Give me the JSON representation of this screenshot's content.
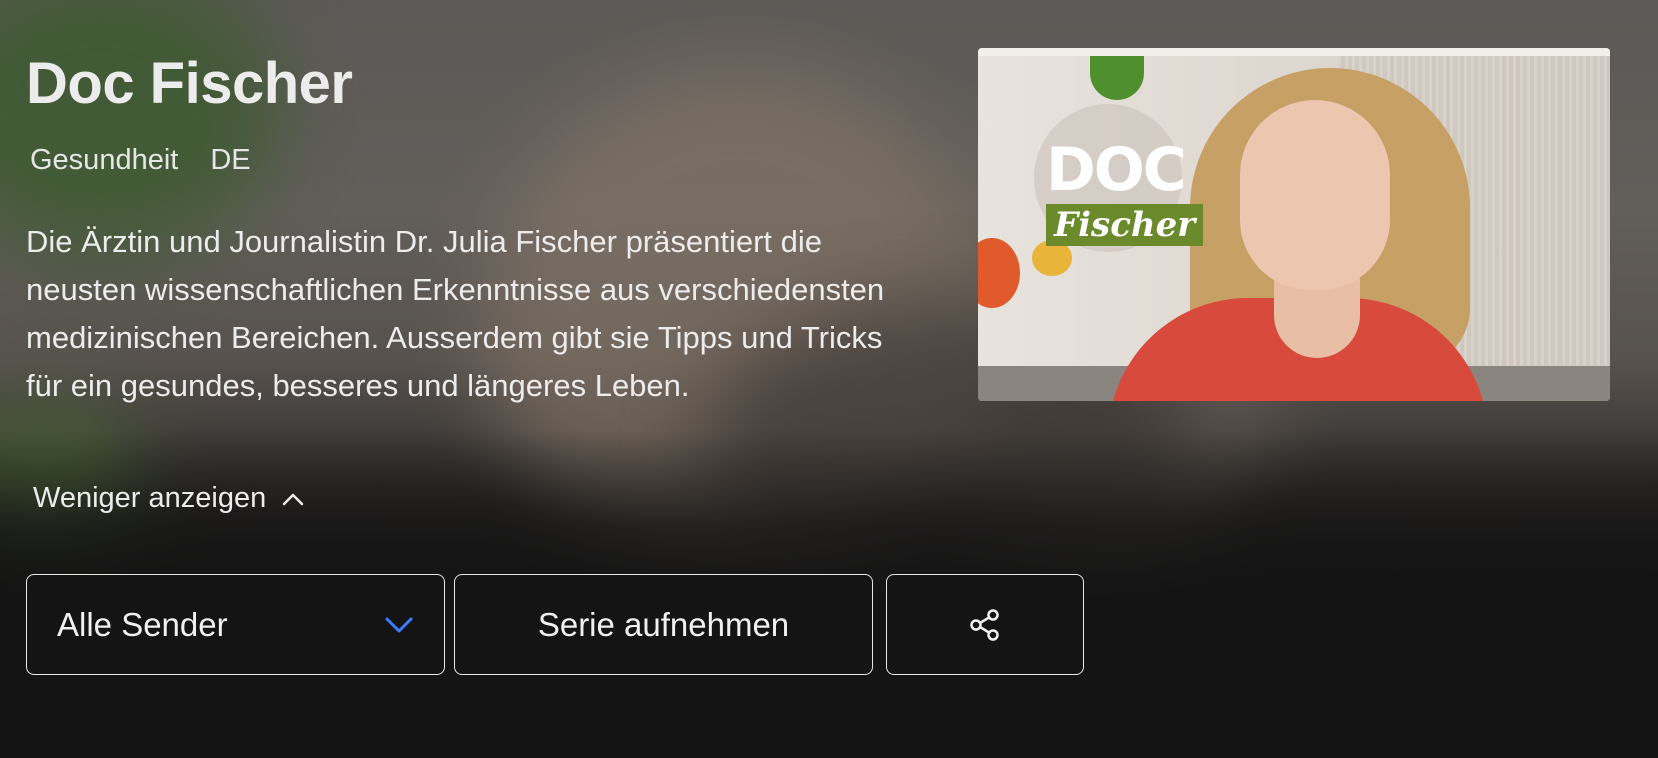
{
  "show": {
    "title": "Doc Fischer",
    "genre": "Gesundheit",
    "language": "DE",
    "description": "Die Ärztin und Journalistin Dr. Julia Fischer präsentiert die neusten wissenschaftlichen Erkenntnisse aus verschiedensten medizinischen Bereichen. Ausserdem gibt sie Tipps und Tricks für ein gesundes, besseres und längeres Leben.",
    "toggle_description_label": "Weniger anzeigen"
  },
  "thumbnail": {
    "logo_line1": "DOC",
    "logo_line2": "Fischer",
    "brand_green": "#6b8a2c"
  },
  "actions": {
    "channel_select_value": "Alle Sender",
    "record_series_label": "Serie aufnehmen",
    "share_icon": "share-icon"
  },
  "colors": {
    "accent_blue": "#3d7bff",
    "background": "#141414",
    "text": "#ececec"
  }
}
